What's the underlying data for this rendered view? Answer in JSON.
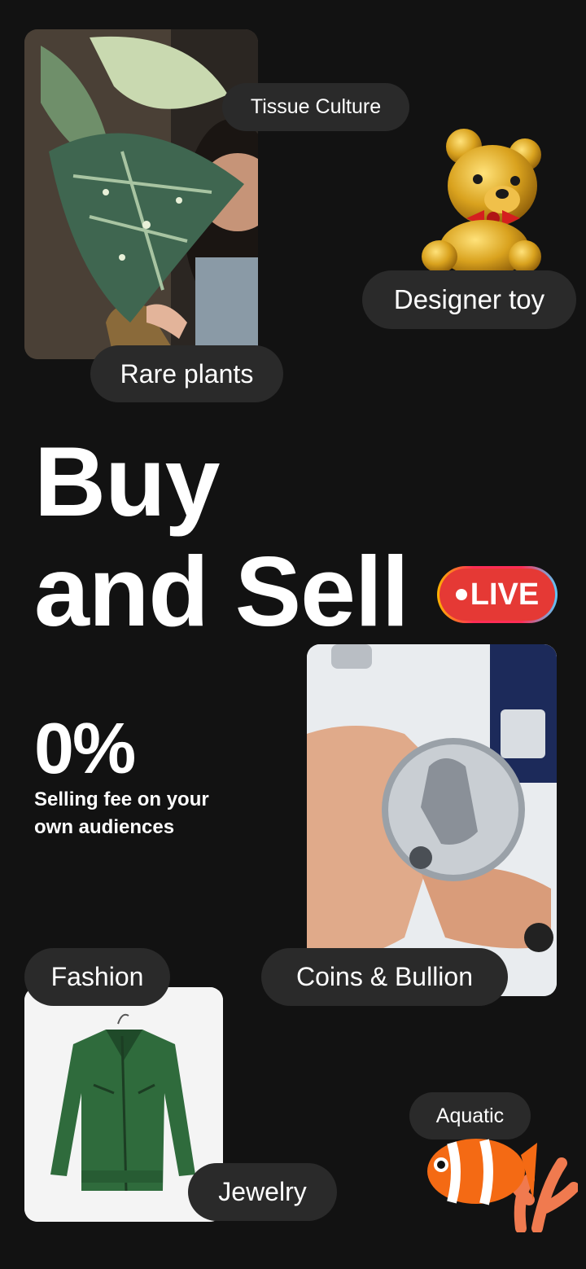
{
  "categories": {
    "tissue_culture": "Tissue Culture",
    "designer_toy": "Designer toy",
    "rare_plants": "Rare plants",
    "fashion": "Fashion",
    "coins_bullion": "Coins & Bullion",
    "aquatic": "Aquatic",
    "jewelry": "Jewelry"
  },
  "hero": {
    "line1": "Buy",
    "line2": "and Sell",
    "live_badge": "LIVE"
  },
  "stat": {
    "value": "0%",
    "description": "Selling fee on your own audiences"
  },
  "colors": {
    "background": "#121212",
    "pill": "#2a2a2a",
    "live_red": "#e53935"
  }
}
